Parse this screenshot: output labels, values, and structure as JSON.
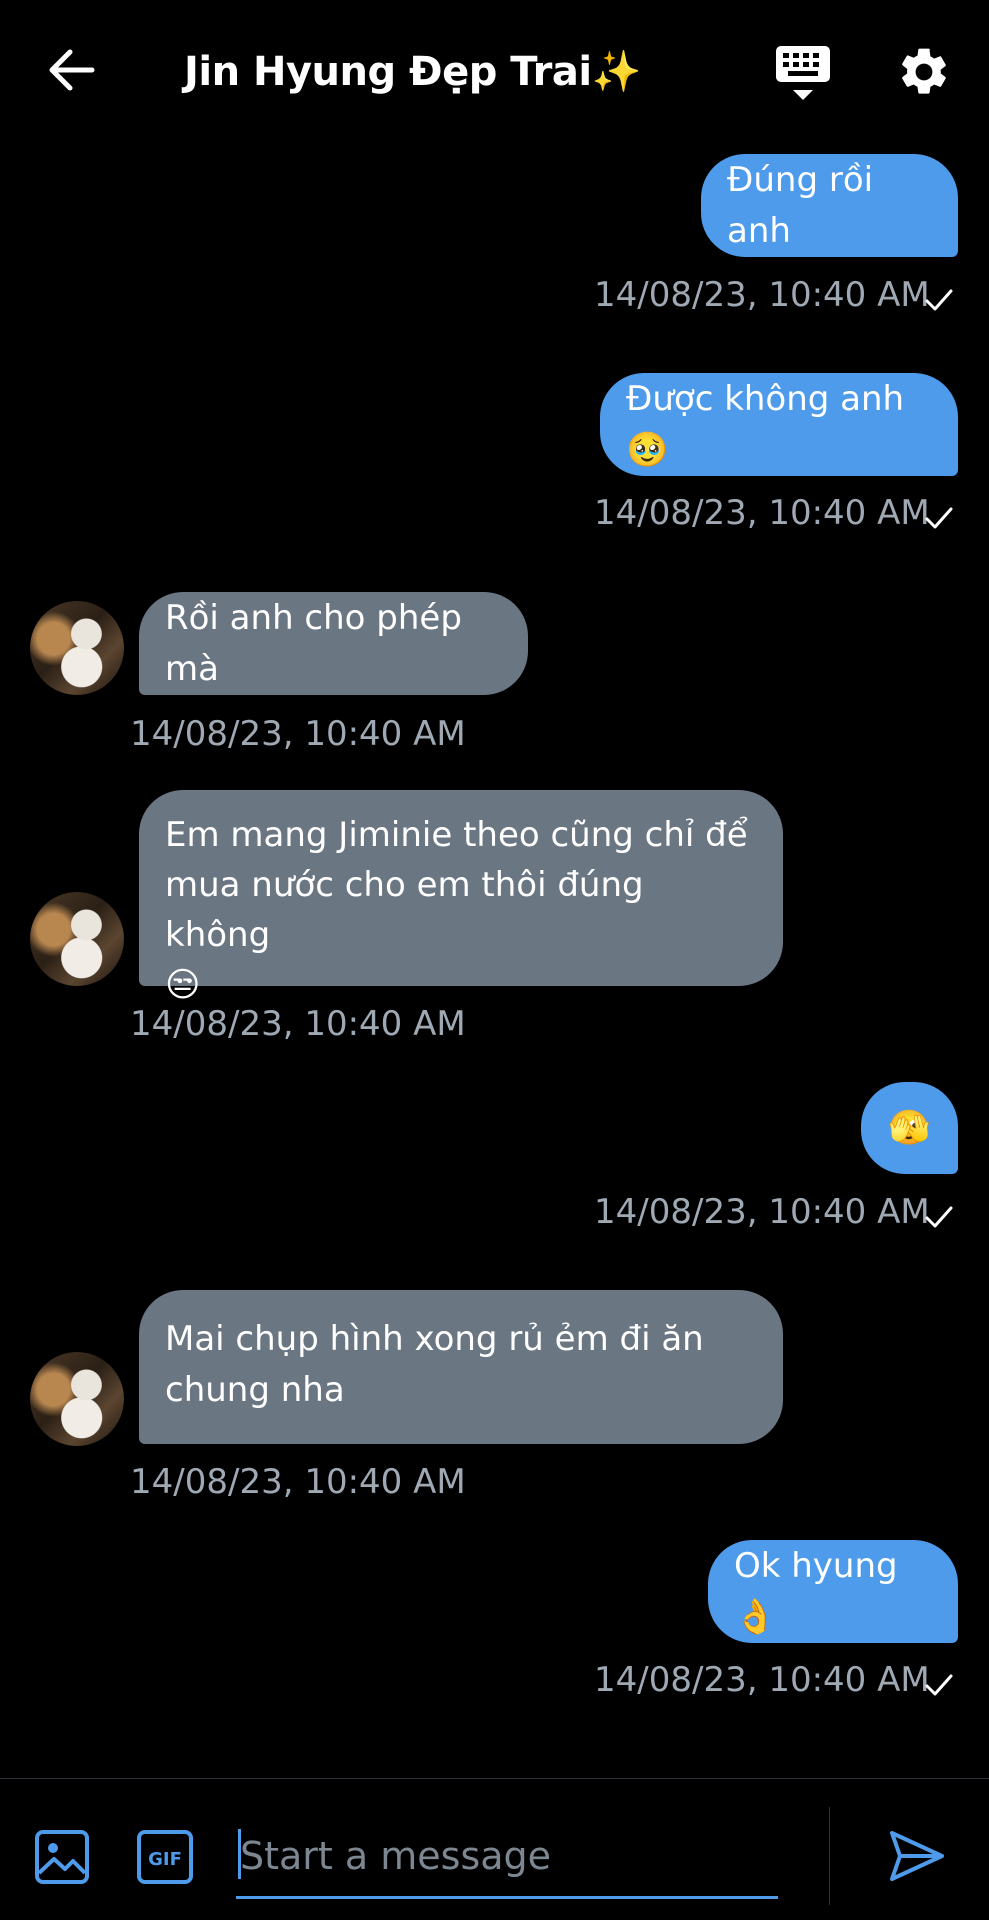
{
  "header": {
    "title": "Jin Hyung Đẹp Trai✨",
    "back_icon": "arrow-left-icon",
    "keyboard_icon": "keyboard-icon",
    "settings_icon": "gear-icon"
  },
  "messages": [
    {
      "from": "me",
      "text": "Đúng rồi anh",
      "timestamp": "14/08/23, 10:40 AM"
    },
    {
      "from": "me",
      "text": "Được không anh🥹",
      "timestamp": "14/08/23, 10:40 AM"
    },
    {
      "from": "them",
      "text": "Rồi anh cho phép mà",
      "timestamp": "14/08/23, 10:40 AM"
    },
    {
      "from": "them",
      "text": "Em mang Jiminie theo cũng chỉ để\nmua nước cho em thôi đúng không\n😒",
      "timestamp": "14/08/23, 10:40 AM"
    },
    {
      "from": "me",
      "text": "🫣",
      "timestamp": "14/08/23, 10:40 AM"
    },
    {
      "from": "them",
      "text": "Mai chụp hình xong rủ ẻm đi ăn\nchung nha",
      "timestamp": "14/08/23, 10:40 AM"
    },
    {
      "from": "me",
      "text": "Ok hyung👌",
      "timestamp": "14/08/23, 10:40 AM"
    }
  ],
  "composer": {
    "placeholder": "Start a message",
    "image_icon": "image-icon",
    "gif_label": "GIF",
    "send_icon": "send-icon"
  },
  "colors": {
    "background": "#000000",
    "sent_bubble": "#4d9bea",
    "received_bubble": "#6b7683",
    "timestamp": "#9fa9b3",
    "accent": "#4d9bea"
  }
}
